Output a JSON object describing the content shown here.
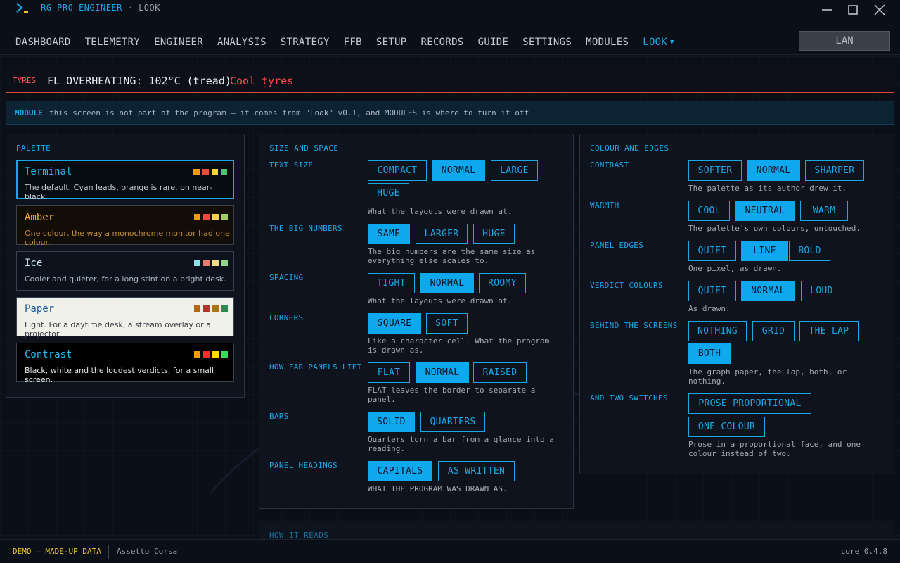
{
  "app": {
    "title": "RG PRO ENGINEER",
    "separator": "·",
    "screen": "LOOK"
  },
  "nav": {
    "items": [
      "DASHBOARD",
      "TELEMETRY",
      "ENGINEER",
      "ANALYSIS",
      "STRATEGY",
      "FFB",
      "SETUP",
      "RECORDS",
      "GUIDE",
      "SETTINGS",
      "MODULES",
      "LOOK"
    ],
    "active": "LOOK",
    "lan_button": "LAN"
  },
  "alert": {
    "tag": "TYRES",
    "message": "FL OVERHEATING: 102°C (tread)",
    "action": "Cool tyres"
  },
  "module_notice": {
    "tag": "MODULE",
    "text": "this screen is not part of the program — it comes from \"Look\" v0.1, and MODULES is where to turn it off"
  },
  "palette": {
    "heading": "PALETTE",
    "cards": [
      {
        "name": "Terminal",
        "desc": "The default. Cyan leads, orange is rare, on near-black.",
        "selected": true,
        "bg": "#070b12",
        "name_color": "#2fb2ec",
        "desc_color": "#c6ccd3",
        "swatches": [
          "#f29a16",
          "#ee4a3e",
          "#f6d24a",
          "#47c96b"
        ]
      },
      {
        "name": "Amber",
        "desc": "One colour, the way a monochrome monitor had one colour.",
        "selected": false,
        "bg": "#120d07",
        "name_color": "#f4a63a",
        "desc_color": "#c58d3c",
        "swatches": [
          "#f29a16",
          "#ee4a3e",
          "#f6d24a",
          "#9fcf62"
        ]
      },
      {
        "name": "Ice",
        "desc": "Cooler and quieter, for a long stint on a bright desk.",
        "selected": false,
        "bg": "#0c121b",
        "name_color": "#cfe6f2",
        "desc_color": "#aab6c2",
        "swatches": [
          "#8de0e6",
          "#e57a6e",
          "#f2dc8a",
          "#8fd48a"
        ]
      },
      {
        "name": "Paper",
        "desc": "Light. For a daytime desk, a stream overlay or a projector.",
        "selected": false,
        "bg": "#f1f1ec",
        "name_color": "#1d5e92",
        "desc_color": "#3a3f46",
        "swatches": [
          "#b96411",
          "#c0302a",
          "#a07a10",
          "#2d8a4e"
        ]
      },
      {
        "name": "Contrast",
        "desc": "Black, white and the loudest verdicts, for a small screen.",
        "selected": false,
        "bg": "#000000",
        "name_color": "#27c0ff",
        "desc_color": "#e6e6e6",
        "swatches": [
          "#ff9a00",
          "#ff2a2a",
          "#ffe000",
          "#2fe05a"
        ]
      }
    ]
  },
  "size_space": {
    "heading": "SIZE AND SPACE",
    "rows": [
      {
        "label": "TEXT SIZE",
        "options": [
          "COMPACT",
          "NORMAL",
          "LARGE",
          "HUGE"
        ],
        "selected": "NORMAL",
        "desc": [
          "What the layouts were drawn at."
        ]
      },
      {
        "label": "THE BIG NUMBERS",
        "options": [
          "SAME",
          "LARGER",
          "HUGE"
        ],
        "selected": "SAME",
        "desc": [
          "The big numbers are the same size as",
          "everything else scales to."
        ]
      },
      {
        "label": "SPACING",
        "options": [
          "TIGHT",
          "NORMAL",
          "ROOMY"
        ],
        "selected": "NORMAL",
        "desc": [
          "What the layouts were drawn at."
        ]
      },
      {
        "label": "CORNERS",
        "options": [
          "SQUARE",
          "SOFT"
        ],
        "selected": "SQUARE",
        "desc": [
          "Like a character cell. What the program",
          "is drawn as."
        ]
      },
      {
        "label": "HOW FAR PANELS LIFT",
        "options": [
          "FLAT",
          "NORMAL",
          "RAISED"
        ],
        "selected": "NORMAL",
        "desc": [
          "FLAT leaves the border to separate a",
          "panel."
        ]
      },
      {
        "label": "BARS",
        "options": [
          "SOLID",
          "QUARTERS"
        ],
        "selected": "SOLID",
        "desc": [
          "Quarters turn a bar from a glance into a",
          "reading."
        ]
      },
      {
        "label": "PANEL HEADINGS",
        "options": [
          "CAPITALS",
          "AS WRITTEN"
        ],
        "selected": "CAPITALS",
        "desc": [
          "WHAT THE PROGRAM WAS DRAWN AS."
        ]
      }
    ]
  },
  "colour_edges": {
    "heading": "COLOUR AND EDGES",
    "rows": [
      {
        "label": "CONTRAST",
        "options": [
          "SOFTER",
          "NORMAL",
          "SHARPER"
        ],
        "selected": "NORMAL",
        "desc": [
          "The palette as its author drew it."
        ]
      },
      {
        "label": "WARMTH",
        "options": [
          "COOL",
          "NEUTRAL",
          "WARM"
        ],
        "selected": "NEUTRAL",
        "desc": [
          "The palette's own colours, untouched."
        ]
      },
      {
        "label": "PANEL EDGES",
        "options": [
          "QUIET",
          "LINE",
          "BOLD"
        ],
        "selected": "LINE",
        "desc": [
          "One pixel, as drawn."
        ]
      },
      {
        "label": "VERDICT COLOURS",
        "options": [
          "QUIET",
          "NORMAL",
          "LOUD"
        ],
        "selected": "NORMAL",
        "desc": [
          "As drawn."
        ]
      },
      {
        "label": "BEHIND THE SCREENS",
        "options": [
          "NOTHING",
          "GRID",
          "THE LAP",
          "BOTH"
        ],
        "selected": "BOTH",
        "desc": [
          "The graph paper, the lap, both, or",
          "nothing."
        ]
      },
      {
        "label": "AND TWO SWITCHES",
        "options": [
          "PROSE PROPORTIONAL",
          "ONE COLOUR"
        ],
        "selected": "",
        "desc": [
          "Prose in a proportional face, and one",
          "colour instead of two."
        ]
      }
    ]
  },
  "how_it_reads": {
    "heading": "HOW IT READS"
  },
  "footer": {
    "demo": "DEMO — MADE-UP DATA",
    "game": "Assetto Corsa",
    "version": "core 0.4.8"
  },
  "colors": {
    "accent": "#1aa7e6",
    "alert": "#e2433f",
    "demo": "#f2c53d"
  }
}
